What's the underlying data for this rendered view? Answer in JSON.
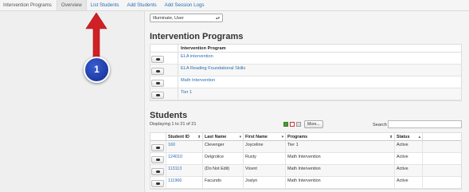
{
  "nav": {
    "brand": "Intervention Programs",
    "tabs": [
      "Overview",
      "List Students",
      "Add Students",
      "Add Session Logs"
    ],
    "active_index": 0
  },
  "user_select": {
    "value": "Illuminate, User"
  },
  "programs": {
    "heading": "Intervention Programs",
    "column": "Intervention Program",
    "items": [
      "ELA intervention",
      "ELA Reading Foundational Skills",
      "Math Intervention",
      "Tier 1"
    ]
  },
  "students": {
    "heading": "Students",
    "displaying": "Displaying 1 to 21 of 21",
    "more_label": "More...",
    "search_label": "Search",
    "columns": [
      "",
      "Student ID",
      "Last Name",
      "First Name",
      "Programs",
      "Status"
    ],
    "rows": [
      [
        "160",
        "Clevenger",
        "Joyceline",
        "Tier 1",
        "Active"
      ],
      [
        "124010",
        "Delgrolice",
        "Rusty",
        "Math Intervention",
        "Active"
      ],
      [
        "113113",
        "(Do Not Edit)",
        "Vicent",
        "Math Intervention",
        "Active"
      ],
      [
        "111966",
        "Facundo",
        "Joslyn",
        "Math Intervention",
        "Active"
      ]
    ]
  },
  "callout": {
    "label": "1"
  },
  "colors": {
    "link": "#2a6fb3",
    "arrow": "#d11f26",
    "callout": "#1d3aa3"
  },
  "icons": [
    "chat-icon",
    "excel-icon",
    "pdf-icon",
    "print-icon",
    "sort-icon"
  ]
}
